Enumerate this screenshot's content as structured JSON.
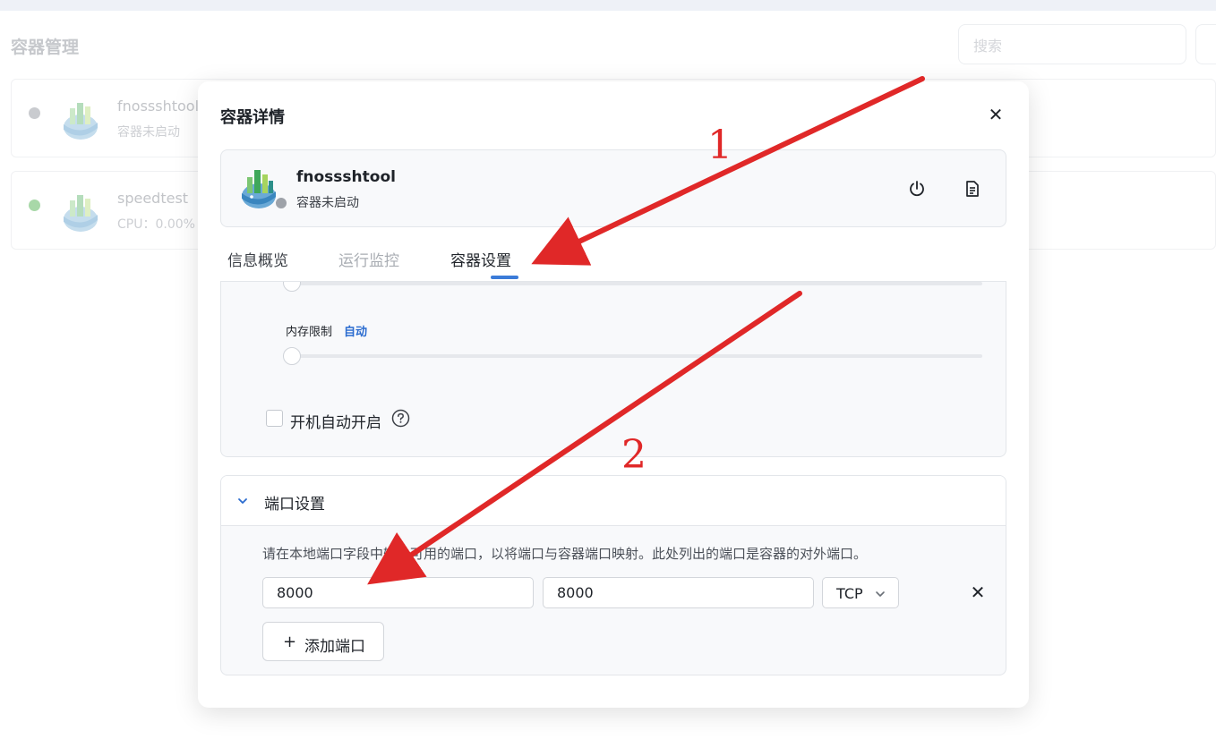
{
  "page": {
    "title": "容器管理",
    "search_placeholder": "搜索"
  },
  "background_list": [
    {
      "name": "fnossshtool",
      "sub": "容器未启动",
      "status_color": "#c9cbcf"
    },
    {
      "name": "speedtest",
      "sub": "CPU：0.00%",
      "status_color": "#a8d8a8"
    }
  ],
  "modal": {
    "title": "容器详情",
    "close_icon": "close-icon",
    "container": {
      "name": "fnossshtool",
      "status_text": "容器未启动",
      "status_color": "#9ea2a9",
      "power_icon": "power-icon",
      "log_icon": "document-icon"
    },
    "tabs": [
      {
        "label": "信息概览",
        "active": false,
        "color": "#3c4047"
      },
      {
        "label": "运行监控",
        "active": false,
        "color": "#a9adb3"
      },
      {
        "label": "容器设置",
        "active": true,
        "color": "#1f2329"
      }
    ],
    "resources": {
      "memory_label": "内存限制",
      "memory_value": "自动",
      "autostart_label": "开机自动开启",
      "autostart_checked": false,
      "help_icon": "question-circle-icon"
    },
    "ports": {
      "section_title": "端口设置",
      "description": "请在本地端口字段中输入可用的端口，以将端口与容器端口映射。此处列出的端口是容器的对外端口。",
      "rows": [
        {
          "local_port": "8000",
          "container_port": "8000",
          "protocol": "TCP"
        }
      ],
      "add_button": "添加端口"
    }
  },
  "annotations": {
    "arrow_color": "#e02828",
    "labels": [
      "1",
      "2"
    ]
  },
  "colors": {
    "accent": "#2a6bcf",
    "tab_indicator": "#3b7bd8"
  }
}
